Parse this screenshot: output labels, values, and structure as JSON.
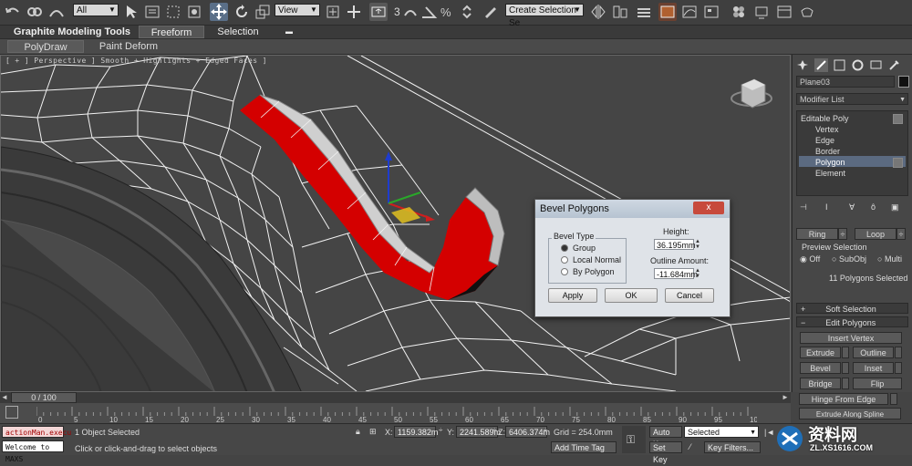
{
  "toolbar": {
    "selection_filter": "All",
    "ref_coord": "View",
    "named_selection": "Create Selection Se",
    "snap_value": "3"
  },
  "ribbon": {
    "app_title": "Graphite Modeling Tools",
    "tabs": [
      "Freeform",
      "Selection"
    ],
    "buttons": [
      "PolyDraw",
      "Paint Deform"
    ]
  },
  "viewport": {
    "label": "[ + ] Perspective ] Smooth + Highlights + Edged Faces ]"
  },
  "dialog": {
    "title": "Bevel Polygons",
    "close": "x",
    "bevel_type_label": "Bevel Type",
    "options": [
      "Group",
      "Local Normal",
      "By Polygon"
    ],
    "selected_option": "Group",
    "height_label": "Height:",
    "height_value": "36.195mm",
    "outline_label": "Outline Amount:",
    "outline_value": "-11.684mm",
    "apply": "Apply",
    "ok": "OK",
    "cancel": "Cancel"
  },
  "command_panel": {
    "object_name": "Plane03",
    "modifier_list": "Modifier List",
    "stack": [
      "Editable Poly",
      "Vertex",
      "Edge",
      "Border",
      "Polygon",
      "Element"
    ],
    "selected_stack_item": "Polygon",
    "ring": "Ring",
    "loop": "Loop",
    "preview_selection": "Preview Selection",
    "preview_options": [
      "Off",
      "SubObj",
      "Multi"
    ],
    "selected_count": "11 Polygons Selected",
    "soft_selection": "Soft Selection",
    "edit_polygons": "Edit Polygons",
    "insert_vertex": "Insert Vertex",
    "extrude": "Extrude",
    "outline": "Outline",
    "bevel": "Bevel",
    "inset": "Inset",
    "bridge": "Bridge",
    "flip": "Flip",
    "hinge": "Hinge From Edge",
    "extrude_spline": "Extrude Along Spline"
  },
  "timeline": {
    "frame": "0 / 100",
    "ticks": [
      "0",
      "5",
      "10",
      "15",
      "20",
      "25",
      "30",
      "35",
      "40",
      "45",
      "50",
      "55",
      "60",
      "65",
      "70",
      "75",
      "80",
      "85",
      "90",
      "95",
      "100"
    ]
  },
  "status": {
    "maxscript_1": "actionMan.execu",
    "maxscript_2": "Welcome to MAXS",
    "objects": "1 Object Selected",
    "prompt": "Click or click-and-drag to select objects",
    "x_label": "X:",
    "x_value": "1159.382m",
    "y_label": "Y:",
    "y_value": "2241.589m",
    "z_label": "Z:",
    "z_value": "6406.374m",
    "grid": "Grid = 254.0mm",
    "add_time_tag": "Add Time Tag",
    "auto_key": "Auto Key",
    "set_key": "Set Key",
    "key_mode": "Selected",
    "key_filters": "Key Filters..."
  },
  "watermark": {
    "brand": "资料网",
    "url": "ZL.XS1616.COM"
  },
  "colors": {
    "selection_red": "#d40000",
    "wire_white": "#f0f0f0",
    "viewport_bg": "#454545",
    "panel_bg": "#474747"
  }
}
